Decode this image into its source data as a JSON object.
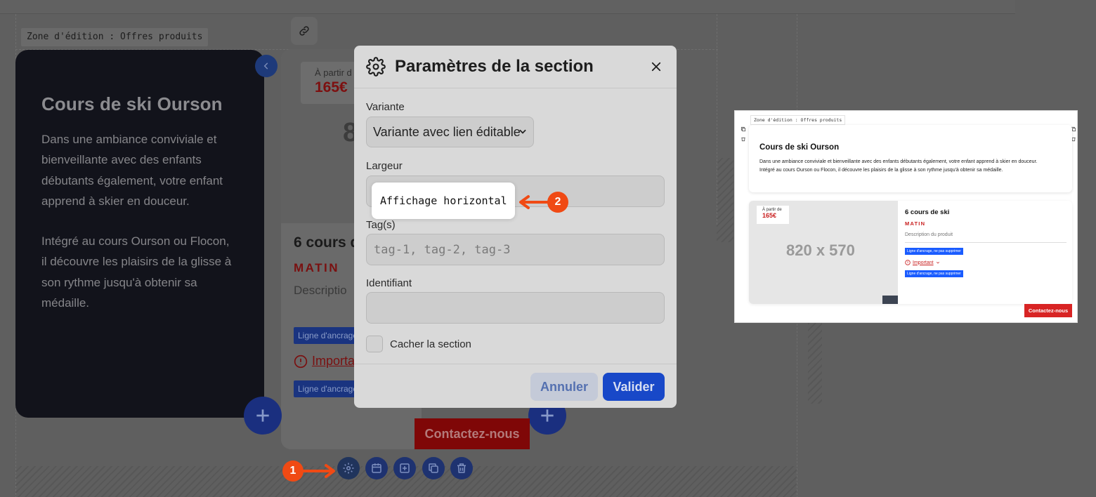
{
  "editor": {
    "zone_label": "Zone d'édition : Offres produits"
  },
  "text_card": {
    "title": "Cours de ski Ourson",
    "paragraph_1": "Dans une ambiance conviviale et bienveillante avec des enfants débutants également, votre enfant apprend à skier en douceur.",
    "paragraph_2": "Intégré au cours Ourson ou Flocon, il découvre les plaisirs de la glisse à son rythme jusqu'à obtenir sa médaille."
  },
  "product_card": {
    "price_from": "À partir d",
    "price_value": "165€",
    "image_size": "8",
    "title": "6 cours d",
    "subtitle": "MATIN",
    "description": "Descriptio",
    "anchor_tag_1": "Ligne d'ancrage",
    "important_label": "Importa",
    "anchor_tag_2": "Ligne d'ancrage",
    "contact_label": "Contactez-nous"
  },
  "modal": {
    "title": "Paramètres de la section",
    "variant_label": "Variante",
    "variant_value": "Variante avec lien éditable",
    "width_label": "Largeur",
    "width_value": "Affichage horizontal",
    "tags_label": "Tag(s)",
    "tags_placeholder": "tag-1, tag-2, tag-3",
    "id_label": "Identifiant",
    "id_value": "",
    "hide_label": "Cacher la section",
    "cancel_label": "Annuler",
    "submit_label": "Valider"
  },
  "markers": {
    "step_1": "1",
    "step_2": "2"
  },
  "preview": {
    "zone_label": "Zone d'édition : Offres produits",
    "title": "Cours de ski Ourson",
    "paragraph_1": "Dans une ambiance conviviale et bienveillante avec des enfants débutants également, votre enfant apprend à skier en douceur.",
    "paragraph_2": "Intégré au cours Ourson ou Flocon, il découvre les plaisirs de la glisse à son rythme jusqu'à obtenir sa médaille.",
    "price_from": "À partir de",
    "price_value": "165€",
    "image_size": "820 x 570",
    "product_title": "6 cours de ski",
    "product_subtitle": "MATIN",
    "product_description": "Description du produit",
    "anchor_tag": "Ligne d'ancrage, ne pas supprimer",
    "important_label": "Important",
    "contact_label": "Contactez-nous"
  },
  "colors": {
    "primary_blue": "#1848c8",
    "accent_red": "#c81e1e",
    "marker_orange": "#f04a14",
    "dark_card": "#12131b"
  }
}
